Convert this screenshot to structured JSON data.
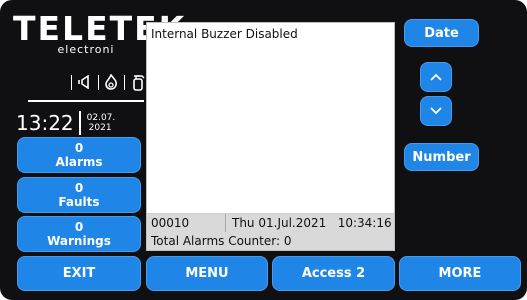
{
  "logo": {
    "brand": "TELETEK",
    "sub": "electroni"
  },
  "status_icons": [
    "speaker-icon",
    "flame-icon",
    "extinguisher-icon"
  ],
  "clock": {
    "time": "13:22",
    "date_line1": "02.07.",
    "date_line2": "2021"
  },
  "side_buttons": [
    {
      "count": "0",
      "label": "Alarms"
    },
    {
      "count": "0",
      "label": "Faults"
    },
    {
      "count": "0",
      "label": "Warnings"
    }
  ],
  "display": {
    "message": "Internal Buzzer Disabled",
    "event_id": "00010",
    "event_timestamp": "Thu 01.Jul.2021   10:34:16",
    "counter_text": "Total Alarms Counter: 0"
  },
  "right_buttons": {
    "date": "Date",
    "number": "Number"
  },
  "bottom_buttons": {
    "exit": "EXIT",
    "menu": "MENU",
    "access": "Access 2",
    "more": "MORE"
  },
  "colors": {
    "panel_bg": "#101012",
    "button_blue": "#1f86e8",
    "display_bg": "#ffffff",
    "status_row_bg": "#d9d9d9"
  }
}
